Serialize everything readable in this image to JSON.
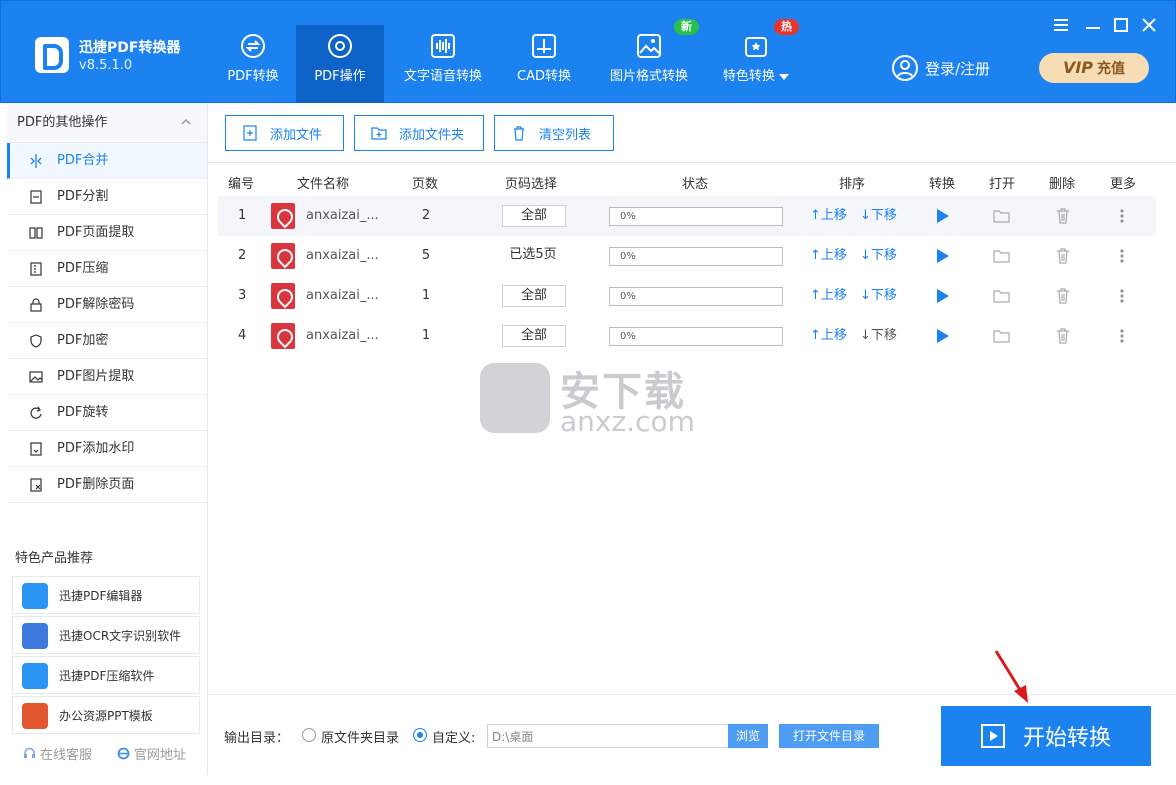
{
  "app": {
    "name": "迅捷PDF转换器",
    "version": "v8.5.1.0"
  },
  "nav": {
    "tabs": [
      {
        "label": "PDF转换",
        "icon": "convert-icon"
      },
      {
        "label": "PDF操作",
        "icon": "gear-icon"
      },
      {
        "label": "文字语音转换",
        "icon": "waveform-icon"
      },
      {
        "label": "CAD转换",
        "icon": "cad-icon"
      },
      {
        "label": "图片格式转换",
        "icon": "image-icon"
      },
      {
        "label": "特色转换",
        "icon": "feature-icon"
      }
    ],
    "badges": {
      "new": "新",
      "hot": "热"
    },
    "active_tab": "PDF操作"
  },
  "account": {
    "login_label": "登录/注册",
    "vip_label": "VIP",
    "recharge_label": "充值"
  },
  "sidebar": {
    "section_title": "PDF的其他操作",
    "items": [
      {
        "label": "PDF合并",
        "icon": "merge-icon"
      },
      {
        "label": "PDF分割",
        "icon": "split-icon"
      },
      {
        "label": "PDF页面提取",
        "icon": "page-extract-icon"
      },
      {
        "label": "PDF压缩",
        "icon": "compress-icon"
      },
      {
        "label": "PDF解除密码",
        "icon": "unlock-icon"
      },
      {
        "label": "PDF加密",
        "icon": "shield-icon"
      },
      {
        "label": "PDF图片提取",
        "icon": "image-extract-icon"
      },
      {
        "label": "PDF旋转",
        "icon": "rotate-icon"
      },
      {
        "label": "PDF添加水印",
        "icon": "watermark-icon"
      },
      {
        "label": "PDF删除页面",
        "icon": "delete-page-icon"
      }
    ],
    "recommend_title": "特色产品推荐",
    "recommend": [
      {
        "label": "迅捷PDF编辑器",
        "icon": "pdf-editor-icon"
      },
      {
        "label": "迅捷OCR文字识别软件",
        "icon": "ocr-icon"
      },
      {
        "label": "迅捷PDF压缩软件",
        "icon": "zip-icon"
      },
      {
        "label": "办公资源PPT模板",
        "icon": "ppt-icon"
      }
    ],
    "footer": {
      "service": "在线客服",
      "website": "官网地址"
    }
  },
  "toolbar": {
    "add_file": "添加文件",
    "add_folder": "添加文件夹",
    "clear_list": "清空列表"
  },
  "table": {
    "headers": {
      "index": "编号",
      "name": "文件名称",
      "pages": "页数",
      "page_select": "页码选择",
      "status": "状态",
      "order": "排序",
      "convert": "转换",
      "open": "打开",
      "delete": "删除",
      "more": "更多"
    },
    "rows": [
      {
        "index": "1",
        "name": "anxaizai_...",
        "pages": "2",
        "page_select": "全部",
        "status": "0%",
        "progress": 0,
        "up": "↑上移",
        "down": "↓下移"
      },
      {
        "index": "2",
        "name": "anxaizai_...",
        "pages": "5",
        "page_select": "已选5页",
        "status": "0%",
        "progress": 0,
        "up": "↑上移",
        "down": "↓下移"
      },
      {
        "index": "3",
        "name": "anxaizai_...",
        "pages": "1",
        "page_select": "全部",
        "status": "0%",
        "progress": 0,
        "up": "↑上移",
        "down": "↓下移"
      },
      {
        "index": "4",
        "name": "anxaizai_...",
        "pages": "1",
        "page_select": "全部",
        "status": "0%",
        "progress": 0,
        "up": "↑上移",
        "down": "↓下移"
      }
    ]
  },
  "watermark": {
    "text_cn": "安下载",
    "text_en": "anxz.com"
  },
  "footer": {
    "output_label": "输出目录：",
    "option_original": "原文件夹目录",
    "option_custom": "自定义:",
    "selected": "custom",
    "path_value": "D:\\桌面",
    "browse": "浏览",
    "open_dir": "打开文件目录",
    "start": "开始转换"
  },
  "colors": {
    "primary": "#1b82f0",
    "active_tab": "#0e63c8",
    "badge_new": "#27c04a",
    "badge_hot": "#e8332f",
    "pdf_red": "#d9363e",
    "vip_bg": "#f6ddb5"
  }
}
